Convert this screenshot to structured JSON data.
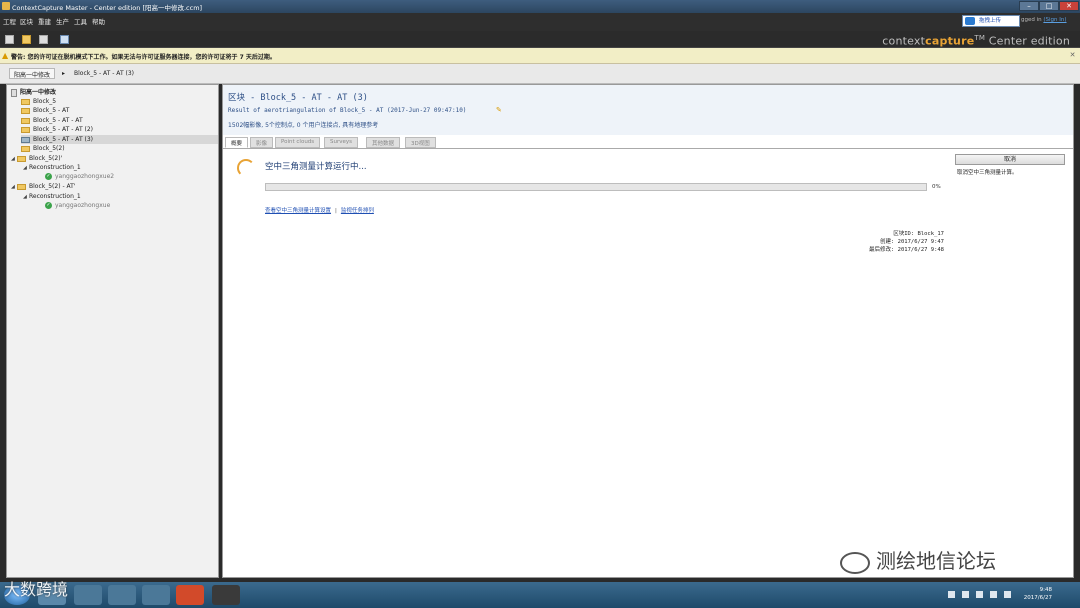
{
  "window": {
    "title": "ContextCapture Master - Center edition [阳高一中修改.ccm]"
  },
  "menu": {
    "items": [
      "工程",
      "区块",
      "重建",
      "生产",
      "工具",
      "帮助"
    ]
  },
  "brand": {
    "prefix": "context",
    "highlight": "capture",
    "tm": "TM",
    "edition": "Center edition"
  },
  "login": {
    "tooltip": "拖拽上传",
    "text": "gged in",
    "link": "(Sign In)"
  },
  "warning": {
    "text": "警告: 您的许可证在脱机模式下工作。如果无法与许可证服务器连接，您的许可证将于 7 天后过期。"
  },
  "breadcrumb": {
    "items": [
      "阳高一中修改",
      "Block_5 - AT - AT (3)"
    ]
  },
  "tree": {
    "root": "阳高一中修改",
    "items": [
      {
        "label": "Block_5",
        "type": "folder"
      },
      {
        "label": "Block_5 - AT",
        "type": "folder"
      },
      {
        "label": "Block_5 - AT - AT",
        "type": "folder"
      },
      {
        "label": "Block_5 - AT - AT (2)",
        "type": "folder"
      },
      {
        "label": "Block_5 - AT - AT (3)",
        "type": "folder"
      },
      {
        "label": "Block_5(2)",
        "type": "folder"
      },
      {
        "label": "Block_5(2)'",
        "type": "folder"
      },
      {
        "label": "Reconstruction_1",
        "type": "node"
      },
      {
        "label": "yanggaozhongxue2",
        "type": "ok"
      },
      {
        "label": "Block_5(2) - AT'",
        "type": "folder"
      },
      {
        "label": "Reconstruction_1",
        "type": "node"
      },
      {
        "label": "yanggaozhongxue",
        "type": "ok"
      }
    ]
  },
  "block": {
    "title": "区块 - Block_5 - AT - AT (3)",
    "subtitle": "Result of aerotriangulation of Block_5 - AT (2017-Jun-27 09:47:10)",
    "summary": "1502幅影像, 5个控制点, 0 个用户连接点, 具有地理参考"
  },
  "tabs": [
    "概要",
    "影像",
    "Point clouds",
    "Surveys",
    "其他数据",
    "3D视图"
  ],
  "task": {
    "status": "空中三角测量计算运行中...",
    "progress_percent": 0,
    "progress_label": "0%",
    "link1": "查看空中三角测量计算设置",
    "separator": "|",
    "link2": "监视任务排列"
  },
  "meta": {
    "id_label": "区块ID:",
    "id_value": "Block_17",
    "created_label": "创建:",
    "created_value": "2017/6/27 9:47",
    "modified_label": "最后修改:",
    "modified_value": "2017/6/27 9:48"
  },
  "actions": {
    "cancel": "取消",
    "cancel_hint": "取消空中三角测量计算。"
  },
  "taskbar": {
    "time": "9:48",
    "date": "2017/6/27"
  },
  "watermarks": {
    "right": "测绘地信论坛",
    "left": "大数跨境"
  },
  "colors": {
    "accent": "#e8a335",
    "link": "#1f4fb3",
    "title": "#2d4f86"
  }
}
